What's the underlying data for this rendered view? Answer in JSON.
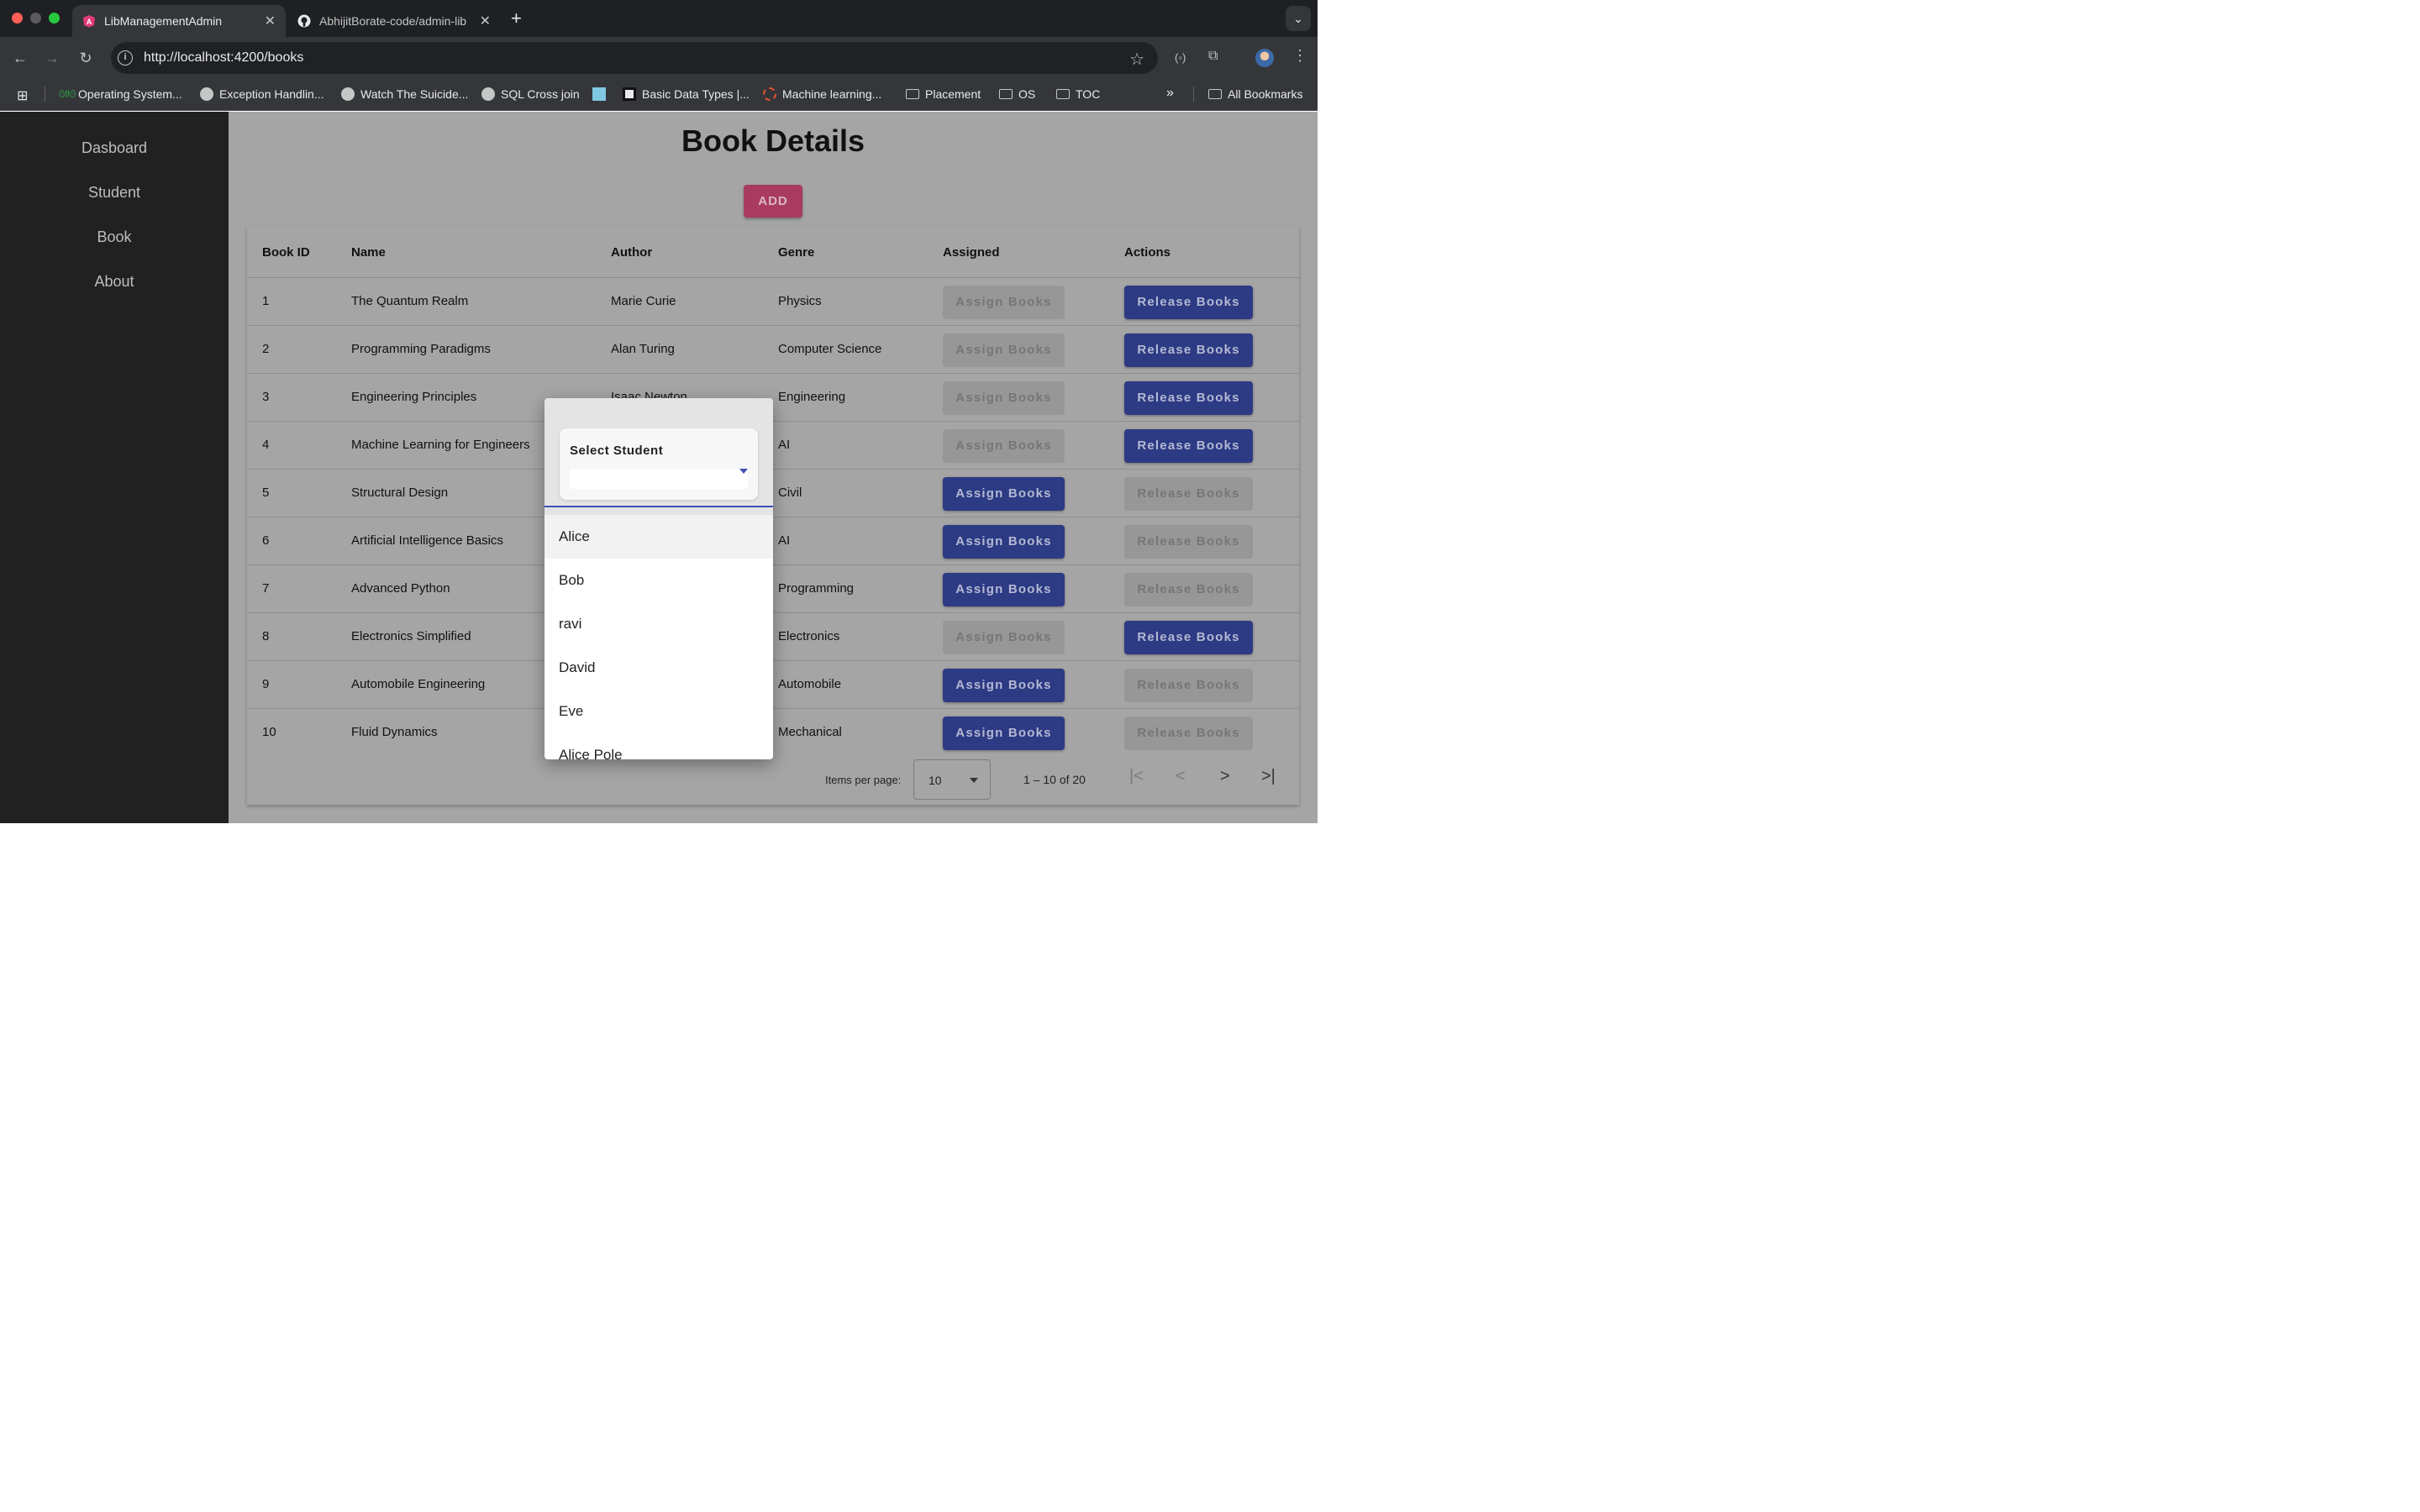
{
  "browser": {
    "tabs": [
      {
        "title": "LibManagementAdmin",
        "active": true
      },
      {
        "title": "AbhijitBorate-code/admin-lib",
        "active": false
      }
    ],
    "url": "http://localhost:4200/books",
    "bookmarks": [
      "Operating System...",
      "Exception Handlin...",
      "Watch The Suicide...",
      "SQL Cross join",
      "Basic Data Types |...",
      "Machine learning...",
      "Placement",
      "OS",
      "TOC"
    ],
    "more_label": "»",
    "all_bookmarks": "All Bookmarks"
  },
  "sidebar": {
    "items": [
      "Dasboard",
      "Student",
      "Book",
      "About"
    ]
  },
  "page": {
    "title": "Book Details",
    "add_label": "ADD"
  },
  "table": {
    "headers": [
      "Book ID",
      "Name",
      "Author",
      "Genre",
      "Assigned",
      "Actions"
    ],
    "assign_label": "Assign Books",
    "release_label": "Release Books",
    "rows": [
      {
        "id": "1",
        "name": "The Quantum Realm",
        "author": "Marie Curie",
        "genre": "Physics",
        "assigned": true
      },
      {
        "id": "2",
        "name": "Programming Paradigms",
        "author": "Alan Turing",
        "genre": "Computer Science",
        "assigned": true
      },
      {
        "id": "3",
        "name": "Engineering Principles",
        "author": "Isaac Newton",
        "genre": "Engineering",
        "assigned": true
      },
      {
        "id": "4",
        "name": "Machine Learning for Engineers",
        "author": "",
        "genre": "AI",
        "assigned": true
      },
      {
        "id": "5",
        "name": "Structural Design",
        "author": "",
        "genre": "Civil",
        "assigned": false
      },
      {
        "id": "6",
        "name": "Artificial Intelligence Basics",
        "author": "",
        "genre": "AI",
        "assigned": false
      },
      {
        "id": "7",
        "name": "Advanced Python",
        "author": "",
        "genre": "Programming",
        "assigned": false
      },
      {
        "id": "8",
        "name": "Electronics Simplified",
        "author": "",
        "genre": "Electronics",
        "assigned": true
      },
      {
        "id": "9",
        "name": "Automobile Engineering",
        "author": "",
        "genre": "Automobile",
        "assigned": false
      },
      {
        "id": "10",
        "name": "Fluid Dynamics",
        "author": "",
        "genre": "Mechanical",
        "assigned": false
      }
    ]
  },
  "paginator": {
    "items_per_page_label": "Items per page:",
    "items_per_page": "10",
    "range": "1 – 10 of 20"
  },
  "student_select": {
    "label": "Select Student",
    "options": [
      "Alice",
      "Bob",
      "ravi",
      "David",
      "Eve",
      "Alice Pole"
    ]
  },
  "colors": {
    "primary": "#2d3a84",
    "accent": "#a83b5f",
    "sidebar": "#212121",
    "select_underline": "#3f51b5"
  }
}
